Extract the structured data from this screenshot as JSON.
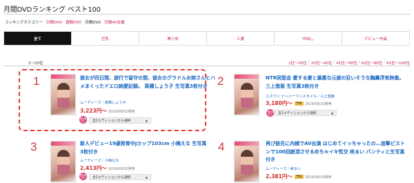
{
  "page": {
    "title": "月間DVDランキング ベスト100"
  },
  "categories": {
    "label": "ランキングカテゴリー",
    "items": [
      {
        "label": "日間DVD",
        "current": false
      },
      {
        "label": "週間DVD",
        "current": false
      },
      {
        "label": "月間DVD",
        "current": true
      },
      {
        "label": "月間AV女優",
        "current": false
      }
    ]
  },
  "tabs": [
    "全て",
    "巨乳",
    "美少女",
    "人妻",
    "中出し",
    "デビュー作品"
  ],
  "range": {
    "current": "1～20位",
    "links": [
      "1位～20位",
      "21位～40位",
      "41位～60位",
      "61位～80位",
      "81位～100位"
    ],
    "separator": "/"
  },
  "items": [
    {
      "rank": "1",
      "title": "彼女が四日間、旅行で留守の間、彼女のグラドルお姉さんとハメまくったドエロ純愛記録。 高橋しょう子 生写真3枚付き",
      "maker": "ムーディーズ",
      "actress": "高橋しょう子",
      "price": "3,223円～",
      "reserve": "",
      "date": "2019/08/02発売",
      "badge": "限定版あり",
      "edition": "全2エディションから選択"
    },
    {
      "rank": "2",
      "title": "NTR同窓会 愛する妻と最悪な元彼の狂いそうな胸糞浮気映像。 三上悠亜 生写真3枚付き",
      "maker": "エスワン ナンバーワンスタイル",
      "actress": "三上悠亜",
      "price": "3,180円～",
      "reserve": "予約",
      "date": "2019/08/20発売",
      "badge": "限定版あり",
      "edition": "全2エディションから選択"
    },
    {
      "rank": "3",
      "title": "新人デビュー19歳発育中Jカップ103cm 小梅えな 生写真3枚付き",
      "maker": "ムーディーズ",
      "actress": "小梅えな",
      "price": "2,413円～",
      "reserve": "",
      "date": "2019/08/02発売",
      "badge": "限定版あり",
      "edition": "全2エディションから選択"
    },
    {
      "rank": "4",
      "title": "再び彼氏に内緒でAV出演 はじめてイッちゃったの…追撃ピストンで100回絶頂させるめちゃイキ性交 柊るい パンティと生写真付き",
      "maker": "ムーディーズ",
      "actress": "柊るい",
      "price": "2,381円～",
      "reserve": "予約",
      "date": "2019/08/14発売",
      "badge": "",
      "edition": ""
    }
  ],
  "colors": {
    "accent": "#c2185b",
    "link": "#1565c0",
    "price": "#d32f2f",
    "rank": "#c93a3a",
    "highlight": "#e53935"
  }
}
